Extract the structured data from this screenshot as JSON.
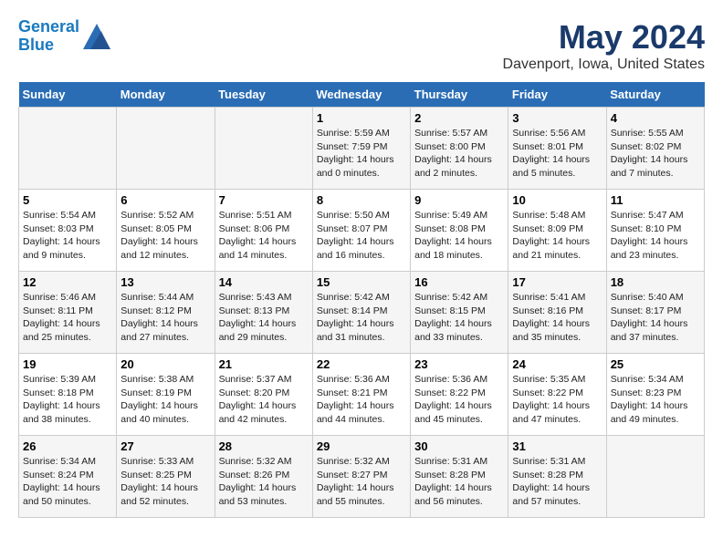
{
  "header": {
    "logo_line1": "General",
    "logo_line2": "Blue",
    "month_title": "May 2024",
    "location": "Davenport, Iowa, United States"
  },
  "days_of_week": [
    "Sunday",
    "Monday",
    "Tuesday",
    "Wednesday",
    "Thursday",
    "Friday",
    "Saturday"
  ],
  "weeks": [
    [
      {
        "day": "",
        "info": ""
      },
      {
        "day": "",
        "info": ""
      },
      {
        "day": "",
        "info": ""
      },
      {
        "day": "1",
        "info": "Sunrise: 5:59 AM\nSunset: 7:59 PM\nDaylight: 14 hours\nand 0 minutes."
      },
      {
        "day": "2",
        "info": "Sunrise: 5:57 AM\nSunset: 8:00 PM\nDaylight: 14 hours\nand 2 minutes."
      },
      {
        "day": "3",
        "info": "Sunrise: 5:56 AM\nSunset: 8:01 PM\nDaylight: 14 hours\nand 5 minutes."
      },
      {
        "day": "4",
        "info": "Sunrise: 5:55 AM\nSunset: 8:02 PM\nDaylight: 14 hours\nand 7 minutes."
      }
    ],
    [
      {
        "day": "5",
        "info": "Sunrise: 5:54 AM\nSunset: 8:03 PM\nDaylight: 14 hours\nand 9 minutes."
      },
      {
        "day": "6",
        "info": "Sunrise: 5:52 AM\nSunset: 8:05 PM\nDaylight: 14 hours\nand 12 minutes."
      },
      {
        "day": "7",
        "info": "Sunrise: 5:51 AM\nSunset: 8:06 PM\nDaylight: 14 hours\nand 14 minutes."
      },
      {
        "day": "8",
        "info": "Sunrise: 5:50 AM\nSunset: 8:07 PM\nDaylight: 14 hours\nand 16 minutes."
      },
      {
        "day": "9",
        "info": "Sunrise: 5:49 AM\nSunset: 8:08 PM\nDaylight: 14 hours\nand 18 minutes."
      },
      {
        "day": "10",
        "info": "Sunrise: 5:48 AM\nSunset: 8:09 PM\nDaylight: 14 hours\nand 21 minutes."
      },
      {
        "day": "11",
        "info": "Sunrise: 5:47 AM\nSunset: 8:10 PM\nDaylight: 14 hours\nand 23 minutes."
      }
    ],
    [
      {
        "day": "12",
        "info": "Sunrise: 5:46 AM\nSunset: 8:11 PM\nDaylight: 14 hours\nand 25 minutes."
      },
      {
        "day": "13",
        "info": "Sunrise: 5:44 AM\nSunset: 8:12 PM\nDaylight: 14 hours\nand 27 minutes."
      },
      {
        "day": "14",
        "info": "Sunrise: 5:43 AM\nSunset: 8:13 PM\nDaylight: 14 hours\nand 29 minutes."
      },
      {
        "day": "15",
        "info": "Sunrise: 5:42 AM\nSunset: 8:14 PM\nDaylight: 14 hours\nand 31 minutes."
      },
      {
        "day": "16",
        "info": "Sunrise: 5:42 AM\nSunset: 8:15 PM\nDaylight: 14 hours\nand 33 minutes."
      },
      {
        "day": "17",
        "info": "Sunrise: 5:41 AM\nSunset: 8:16 PM\nDaylight: 14 hours\nand 35 minutes."
      },
      {
        "day": "18",
        "info": "Sunrise: 5:40 AM\nSunset: 8:17 PM\nDaylight: 14 hours\nand 37 minutes."
      }
    ],
    [
      {
        "day": "19",
        "info": "Sunrise: 5:39 AM\nSunset: 8:18 PM\nDaylight: 14 hours\nand 38 minutes."
      },
      {
        "day": "20",
        "info": "Sunrise: 5:38 AM\nSunset: 8:19 PM\nDaylight: 14 hours\nand 40 minutes."
      },
      {
        "day": "21",
        "info": "Sunrise: 5:37 AM\nSunset: 8:20 PM\nDaylight: 14 hours\nand 42 minutes."
      },
      {
        "day": "22",
        "info": "Sunrise: 5:36 AM\nSunset: 8:21 PM\nDaylight: 14 hours\nand 44 minutes."
      },
      {
        "day": "23",
        "info": "Sunrise: 5:36 AM\nSunset: 8:22 PM\nDaylight: 14 hours\nand 45 minutes."
      },
      {
        "day": "24",
        "info": "Sunrise: 5:35 AM\nSunset: 8:22 PM\nDaylight: 14 hours\nand 47 minutes."
      },
      {
        "day": "25",
        "info": "Sunrise: 5:34 AM\nSunset: 8:23 PM\nDaylight: 14 hours\nand 49 minutes."
      }
    ],
    [
      {
        "day": "26",
        "info": "Sunrise: 5:34 AM\nSunset: 8:24 PM\nDaylight: 14 hours\nand 50 minutes."
      },
      {
        "day": "27",
        "info": "Sunrise: 5:33 AM\nSunset: 8:25 PM\nDaylight: 14 hours\nand 52 minutes."
      },
      {
        "day": "28",
        "info": "Sunrise: 5:32 AM\nSunset: 8:26 PM\nDaylight: 14 hours\nand 53 minutes."
      },
      {
        "day": "29",
        "info": "Sunrise: 5:32 AM\nSunset: 8:27 PM\nDaylight: 14 hours\nand 55 minutes."
      },
      {
        "day": "30",
        "info": "Sunrise: 5:31 AM\nSunset: 8:28 PM\nDaylight: 14 hours\nand 56 minutes."
      },
      {
        "day": "31",
        "info": "Sunrise: 5:31 AM\nSunset: 8:28 PM\nDaylight: 14 hours\nand 57 minutes."
      },
      {
        "day": "",
        "info": ""
      }
    ]
  ]
}
